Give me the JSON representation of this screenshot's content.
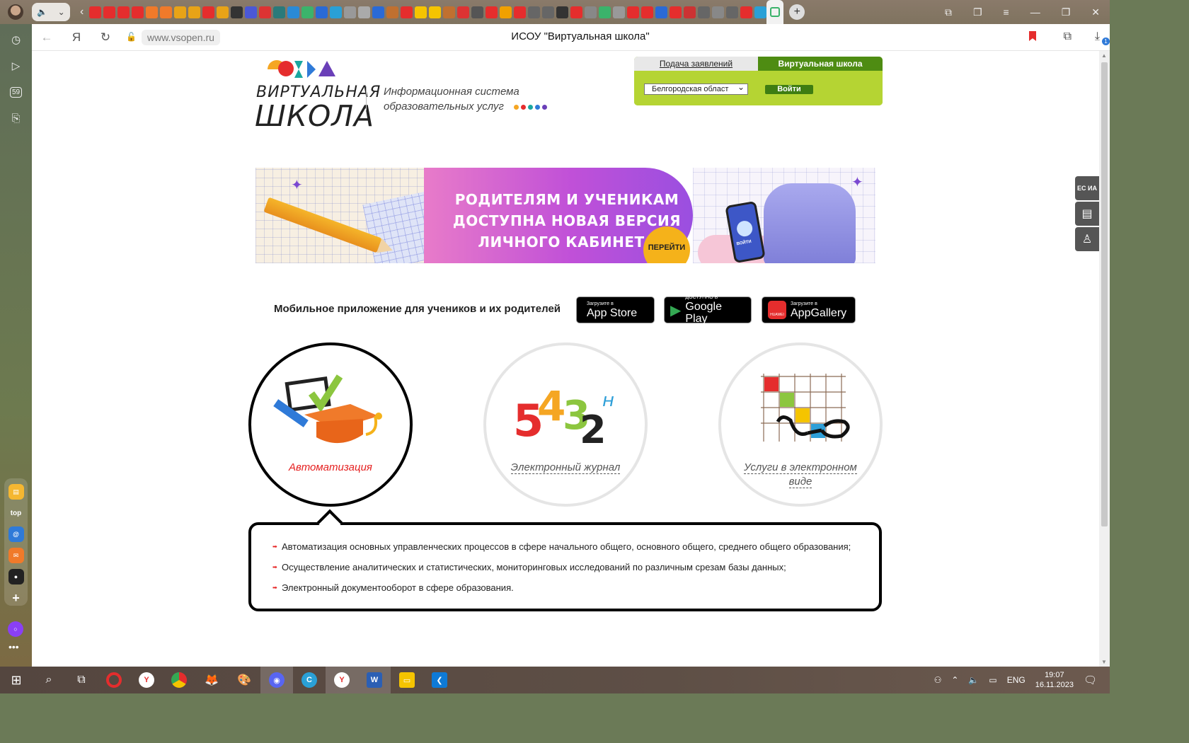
{
  "browser": {
    "url": "www.vsopen.ru",
    "tab_title": "ИСОУ \"Виртуальная школа\"",
    "calendar_day": "59",
    "download_badge": "1",
    "tab_icon_colors": [
      "#e52d2d",
      "#e52d2d",
      "#e52d2d",
      "#e52d2d",
      "#f07a2a",
      "#f07a2a",
      "#e8a317",
      "#e8a317",
      "#e52d2d",
      "#e8a317",
      "#333",
      "#4b58d6",
      "#d33",
      "#2a7a7a",
      "#2a8ad6",
      "#3bb36b",
      "#2a6ad6",
      "#2aa0d6",
      "#999",
      "#aaa",
      "#2a6ad6",
      "#c07030",
      "#e52d2d",
      "#f5c400",
      "#f5c400",
      "#c07030",
      "#d33",
      "#555",
      "#e52d2d",
      "#f0a000",
      "#e52d2d",
      "#666",
      "#666",
      "#333",
      "#e52d2d",
      "#888",
      "#3bb36b",
      "#999",
      "#e52d2d",
      "#e52d2d",
      "#2a6ad6",
      "#e52d2d",
      "#c33",
      "#666",
      "#888",
      "#666",
      "#e52d2d",
      "#2aa0d6"
    ]
  },
  "site": {
    "logo_line1": "ВИРТУАЛЬНАЯ",
    "logo_line2": "ШКОЛА",
    "subtitle_line1": "Информационная система",
    "subtitle_line2": "образовательных услуг",
    "login": {
      "tab_apply": "Подача заявлений",
      "tab_school": "Виртуальная школа",
      "region": "Белгородская област",
      "button": "Войти"
    },
    "banner": {
      "line1": "РОДИТЕЛЯМ И УЧЕНИКАМ",
      "line2": "ДОСТУПНА НОВАЯ ВЕРСИЯ",
      "line3": "ЛИЧНОГО КАБИНЕТА",
      "go": "ПЕРЕЙТИ",
      "phone_label": "ВОЙТИ"
    },
    "apps": {
      "label": "Мобильное приложение для учеников и их родителей",
      "appstore_small": "Загрузите в",
      "appstore_big": "App Store",
      "gplay_small": "ДОСТУПНО В",
      "gplay_big": "Google Play",
      "appgallery_small": "Загрузите в",
      "appgallery_big": "AppGallery",
      "huawei": "HUAWEI"
    },
    "services": [
      {
        "label": "Автоматизация"
      },
      {
        "label": "Электронный журнал"
      },
      {
        "label": "Услуги в электронном виде"
      }
    ],
    "journal_digits": [
      "5",
      "4",
      "3",
      "2",
      "н"
    ],
    "description": [
      "Автоматизация основных управленческих процессов в сфере начального общего, основного общего, среднего общего образования;",
      "Осуществление аналитических и статистических, мониторинговых исследований по различным срезам базы данных;",
      "Электронный документооборот в сфере образования."
    ],
    "float_buttons": {
      "esia": "ЕС ИА"
    }
  },
  "taskbar": {
    "lang": "ENG",
    "time": "19:07",
    "date": "16.11.2023"
  }
}
